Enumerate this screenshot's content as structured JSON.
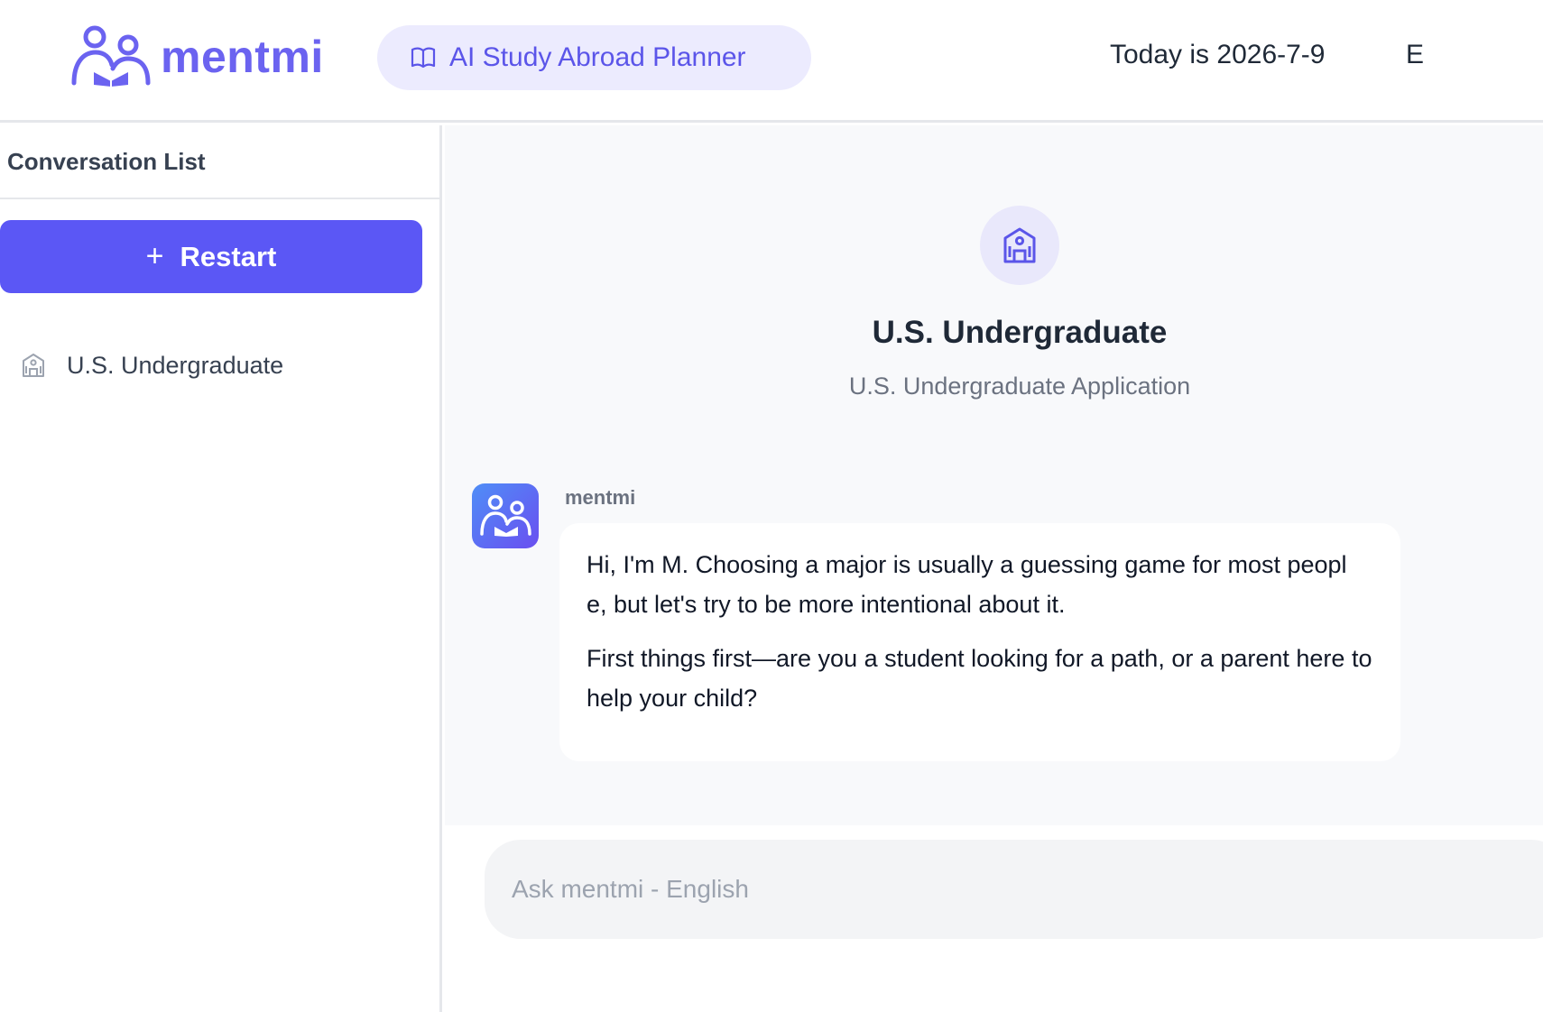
{
  "header": {
    "brand": "mentmi",
    "planner_label": "AI Study Abroad Planner",
    "date_text": "Today is 2026-7-9",
    "cutoff_text": "E"
  },
  "sidebar": {
    "title": "Conversation List",
    "restart_label": "Restart",
    "conversations": [
      {
        "label": "U.S. Undergraduate",
        "icon": "school-icon"
      }
    ]
  },
  "main": {
    "hero_title": "U.S. Undergraduate",
    "hero_subtitle": "U.S. Undergraduate Application",
    "message": {
      "sender": "mentmi",
      "paragraphs": [
        "Hi, I'm M. Choosing a major is usually a guessing game for most peopl e, but let's try to be more intentional about it.",
        "First things first—are you a student looking for a path, or a parent here to help your child?"
      ]
    }
  },
  "input": {
    "placeholder": "Ask mentmi - English",
    "value": ""
  },
  "colors": {
    "brand": "#6b63f0",
    "primary_button": "#5b57f5",
    "pill_bg": "#ecebfe"
  }
}
